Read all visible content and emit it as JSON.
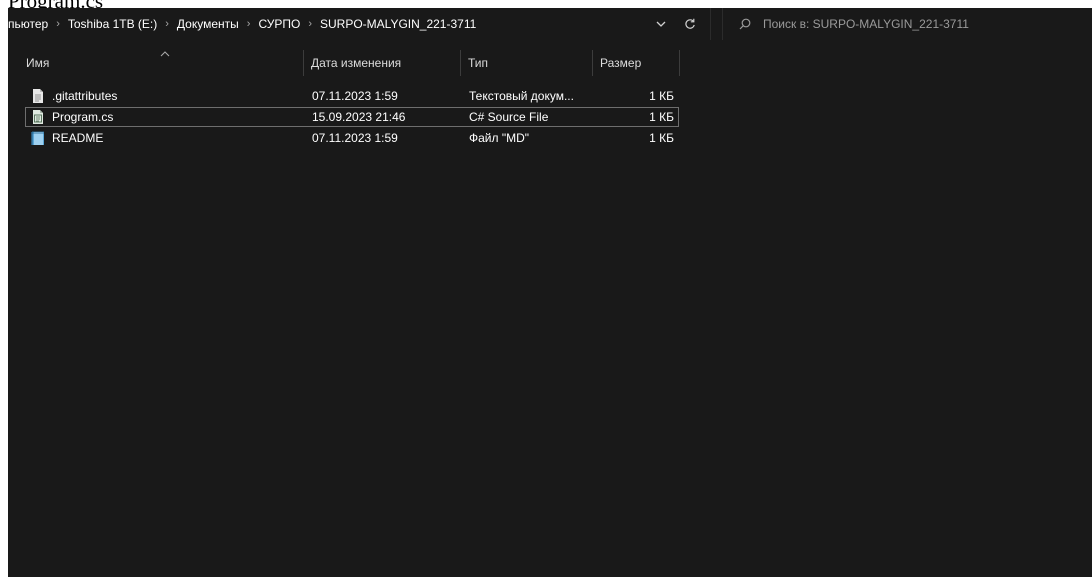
{
  "caption": "Program.cs",
  "address_bar": {
    "crumbs": [
      "пьютер",
      "Toshiba 1TB (E:)",
      "Документы",
      "СУРПО",
      "SURPO-MALYGIN_221-3711"
    ],
    "separator": "›"
  },
  "search": {
    "placeholder": "Поиск в: SURPO-MALYGIN_221-3711"
  },
  "columns": {
    "name": "Имя",
    "date": "Дата изменения",
    "type": "Тип",
    "size": "Размер"
  },
  "files": [
    {
      "name": ".gitattributes",
      "date": "07.11.2023 1:59",
      "type": "Текстовый докум...",
      "size": "1 КБ",
      "icon": "text-file-icon",
      "selected": false
    },
    {
      "name": "Program.cs",
      "date": "15.09.2023 21:46",
      "type": "C# Source File",
      "size": "1 КБ",
      "icon": "cs-file-icon",
      "selected": true
    },
    {
      "name": "README",
      "date": "07.11.2023 1:59",
      "type": "Файл \"MD\"",
      "size": "1 КБ",
      "icon": "md-file-icon",
      "selected": false
    }
  ],
  "colors": {
    "background": "#191919",
    "text": "#ffffff",
    "muted": "#9a9a9a",
    "selection_border": "#6e6e6e"
  }
}
